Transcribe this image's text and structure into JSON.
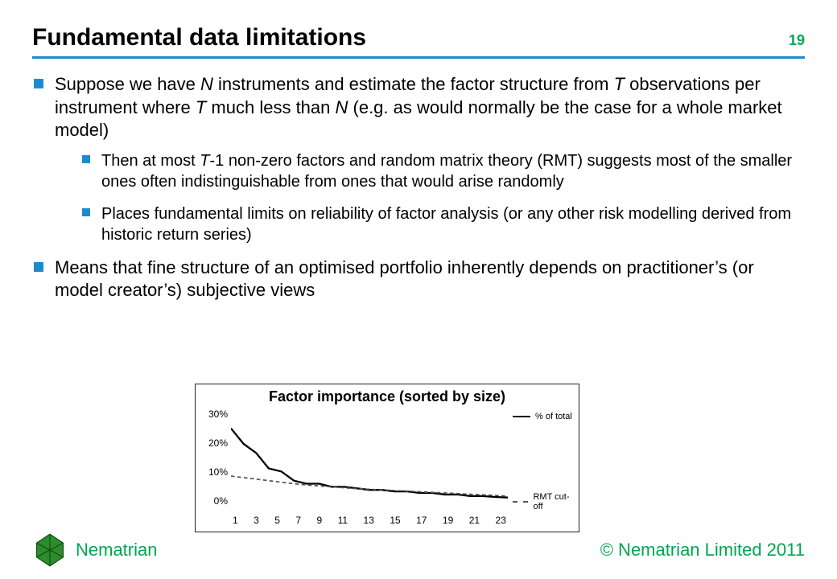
{
  "header": {
    "title": "Fundamental data limitations",
    "page_number": "19"
  },
  "bullets": {
    "item0": {
      "pre": "Suppose we have ",
      "n": "N",
      "mid1": " instruments and estimate the factor structure from ",
      "t": "T",
      "mid2": " observations per instrument where ",
      "t2": "T",
      "mid3": " much less than ",
      "n2": "N",
      "post": " (e.g. as would normally be the case for a whole market model)"
    },
    "sub0": {
      "pre": "Then at most ",
      "t": "T",
      "post": "-1 non-zero factors and random matrix theory (RMT) suggests most of the smaller ones often indistinguishable from ones that would arise randomly"
    },
    "sub1": "Places fundamental limits on reliability of factor analysis (or any other risk modelling derived from historic return series)",
    "item1": "Means that fine structure of an optimised portfolio inherently depends on practitioner’s (or model creator’s) subjective views"
  },
  "footer": {
    "brand": "Nematrian",
    "copyright": "© Nematrian Limited 2011"
  },
  "chart_data": {
    "type": "line",
    "title": "Factor importance (sorted by size)",
    "xlabel": "",
    "ylabel": "",
    "ylim": [
      0,
      30
    ],
    "x": [
      1,
      2,
      3,
      4,
      5,
      6,
      7,
      8,
      9,
      10,
      11,
      12,
      13,
      14,
      15,
      16,
      17,
      18,
      19,
      20,
      21,
      22,
      23
    ],
    "x_ticks": [
      "1",
      "3",
      "5",
      "7",
      "9",
      "11",
      "13",
      "15",
      "17",
      "19",
      "21",
      "23"
    ],
    "y_ticks": [
      "30%",
      "20%",
      "10%",
      "0%"
    ],
    "series": [
      {
        "name": "% of total",
        "style": "solid",
        "values": [
          23,
          18,
          15,
          10,
          9,
          6,
          5,
          5,
          4,
          4,
          3.5,
          3,
          3,
          2.5,
          2.5,
          2,
          2,
          1.5,
          1.5,
          1,
          1,
          0.7,
          0.5
        ]
      },
      {
        "name": "RMT cut-off",
        "style": "dashed",
        "values": [
          7.5,
          7,
          6.5,
          6,
          5.5,
          5,
          4.6,
          4.3,
          4,
          3.7,
          3.4,
          3.2,
          3,
          2.8,
          2.6,
          2.4,
          2.2,
          2,
          1.8,
          1.6,
          1.4,
          1.2,
          1
        ]
      }
    ],
    "legend": {
      "s0": "% of total",
      "s1": "RMT cut-off"
    }
  }
}
